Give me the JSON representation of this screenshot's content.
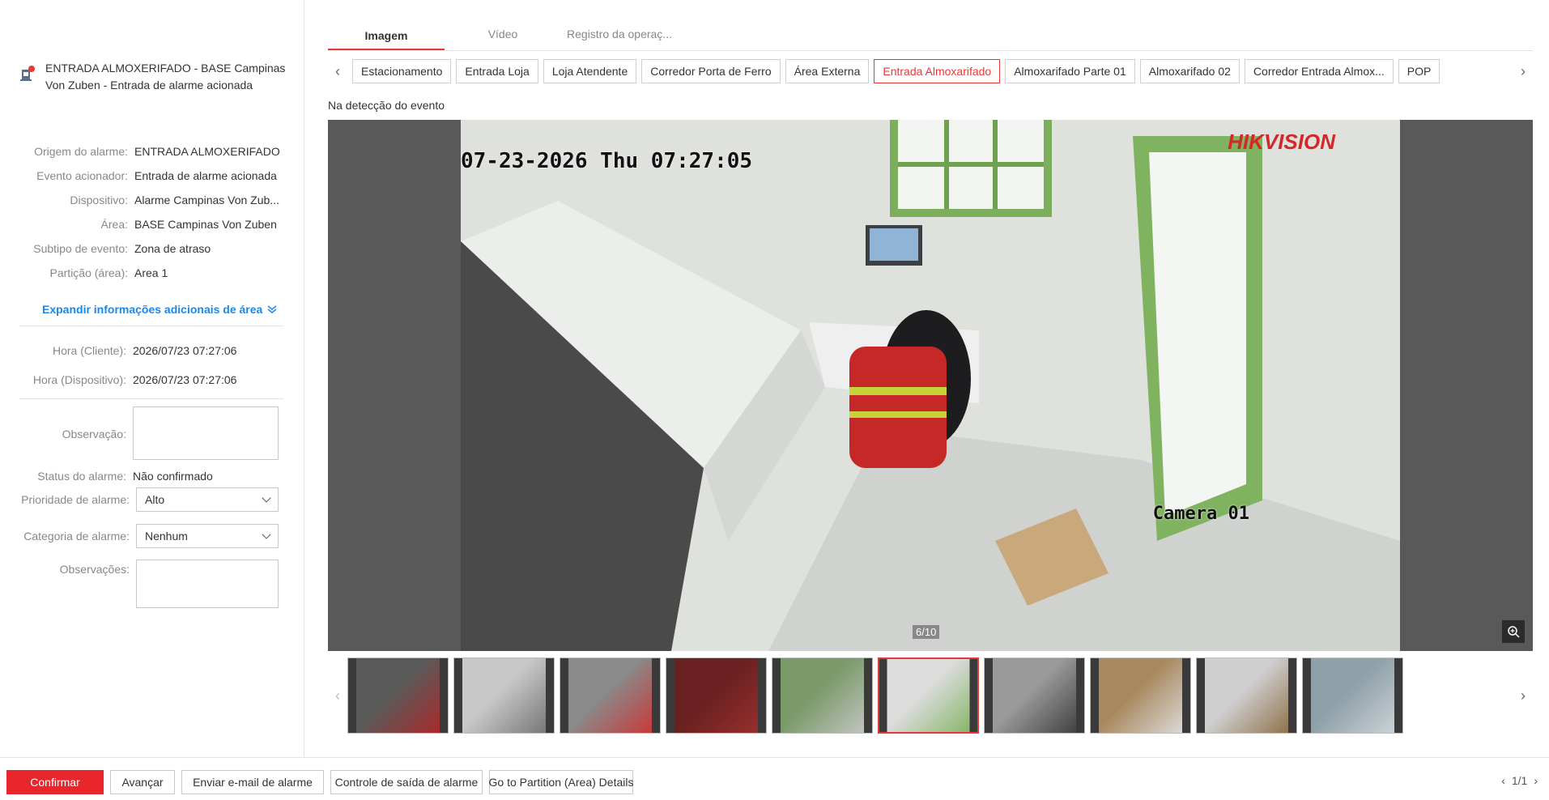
{
  "alarm": {
    "title": "ENTRADA ALMOXERIFADO - BASE Campinas Von Zuben - Entrada de alarme acionada",
    "icon": "alarm-device-icon"
  },
  "info": [
    {
      "label": "Origem do alarme:",
      "value": "ENTRADA ALMOXERIFADO"
    },
    {
      "label": "Evento acionador:",
      "value": "Entrada de alarme acionada"
    },
    {
      "label": "Dispositivo:",
      "value": "Alarme Campinas Von Zub..."
    },
    {
      "label": "Área:",
      "value": "BASE Campinas Von Zuben"
    },
    {
      "label": "Subtipo de evento:",
      "value": "Zona de atraso"
    },
    {
      "label": "Partição (área):",
      "value": "Area 1"
    }
  ],
  "expand_label": "Expandir informações adicionais de área",
  "times": [
    {
      "label": "Hora (Cliente):",
      "value": "2026/07/23 07:27:06"
    },
    {
      "label": "Hora (Dispositivo):",
      "value": "2026/07/23 07:27:06"
    }
  ],
  "form": {
    "observacao_label": "Observação:",
    "status_label": "Status do alarme:",
    "status_value": "Não confirmado",
    "prioridade_label": "Prioridade de alarme:",
    "prioridade_value": "Alto",
    "categoria_label": "Categoria de alarme:",
    "categoria_value": "Nenhum",
    "observacoes_label": "Observações:"
  },
  "tabs": [
    "Imagem",
    "Vídeo",
    "Registro da operaç..."
  ],
  "cameras": [
    "Estacionamento",
    "Entrada Loja",
    "Loja Atendente",
    "Corredor Porta de Ferro",
    "Área Externa",
    "Entrada Almoxarifado",
    "Almoxarifado Parte 01",
    "Almoxarifado 02",
    "Corredor Entrada Almox...",
    "POP"
  ],
  "active_camera": "Entrada Almoxarifado",
  "event_label": "Na detecção do evento",
  "osd": {
    "timestamp": "07-23-2026 Thu 07:27:05",
    "brand_a": "HIK",
    "brand_b": "VISION",
    "camera": "Camera 01"
  },
  "image_counter": "6/10",
  "active_thumb": 6,
  "footer": {
    "confirm": "Confirmar",
    "next": "Avançar",
    "email": "Enviar e-mail de alarme",
    "exit_control": "Controle de saída de alarme",
    "partition": "Go to Partition (Area) Details",
    "pager": "1/1"
  },
  "colors": {
    "accent": "#e8262b",
    "link": "#1e88e5"
  }
}
